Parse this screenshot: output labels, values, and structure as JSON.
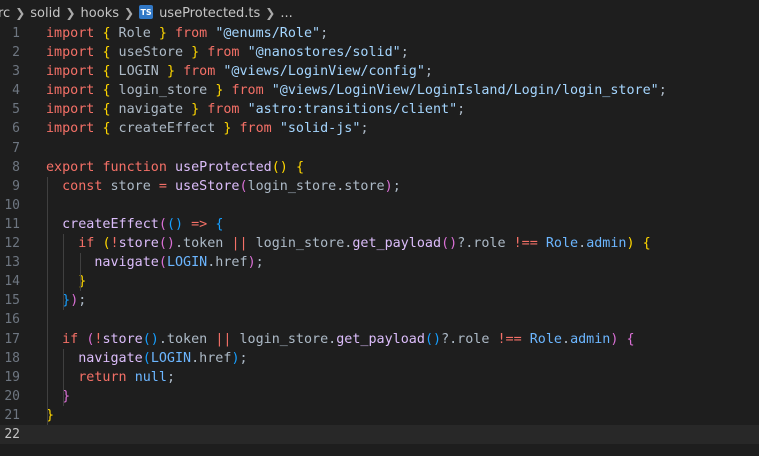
{
  "breadcrumb": {
    "items": [
      "rc",
      "solid",
      "hooks",
      "useProtected.ts",
      "..."
    ],
    "file_icon": "TS"
  },
  "editor": {
    "current_line": 22,
    "lines": [
      {
        "n": "1",
        "tokens": [
          [
            "kw",
            "import"
          ],
          [
            "p",
            " "
          ],
          [
            "b1",
            "{"
          ],
          [
            "p",
            " Role "
          ],
          [
            "b1",
            "}"
          ],
          [
            "p",
            " "
          ],
          [
            "kw",
            "from"
          ],
          [
            "p",
            " "
          ],
          [
            "str",
            "\"@enums/Role\""
          ],
          [
            "p",
            ";"
          ]
        ]
      },
      {
        "n": "2",
        "tokens": [
          [
            "kw",
            "import"
          ],
          [
            "p",
            " "
          ],
          [
            "b1",
            "{"
          ],
          [
            "p",
            " useStore "
          ],
          [
            "b1",
            "}"
          ],
          [
            "p",
            " "
          ],
          [
            "kw",
            "from"
          ],
          [
            "p",
            " "
          ],
          [
            "str",
            "\"@nanostores/solid\""
          ],
          [
            "p",
            ";"
          ]
        ]
      },
      {
        "n": "3",
        "tokens": [
          [
            "kw",
            "import"
          ],
          [
            "p",
            " "
          ],
          [
            "b1",
            "{"
          ],
          [
            "p",
            " LOGIN "
          ],
          [
            "b1",
            "}"
          ],
          [
            "p",
            " "
          ],
          [
            "kw",
            "from"
          ],
          [
            "p",
            " "
          ],
          [
            "str",
            "\"@views/LoginView/config\""
          ],
          [
            "p",
            ";"
          ]
        ]
      },
      {
        "n": "4",
        "tokens": [
          [
            "kw",
            "import"
          ],
          [
            "p",
            " "
          ],
          [
            "b1",
            "{"
          ],
          [
            "p",
            " login_store "
          ],
          [
            "b1",
            "}"
          ],
          [
            "p",
            " "
          ],
          [
            "kw",
            "from"
          ],
          [
            "p",
            " "
          ],
          [
            "str",
            "\"@views/LoginView/LoginIsland/Login/login_store\""
          ],
          [
            "p",
            ";"
          ]
        ]
      },
      {
        "n": "5",
        "tokens": [
          [
            "kw",
            "import"
          ],
          [
            "p",
            " "
          ],
          [
            "b1",
            "{"
          ],
          [
            "p",
            " navigate "
          ],
          [
            "b1",
            "}"
          ],
          [
            "p",
            " "
          ],
          [
            "kw",
            "from"
          ],
          [
            "p",
            " "
          ],
          [
            "str",
            "\"astro:transitions/client\""
          ],
          [
            "p",
            ";"
          ]
        ]
      },
      {
        "n": "6",
        "tokens": [
          [
            "kw",
            "import"
          ],
          [
            "p",
            " "
          ],
          [
            "b1",
            "{"
          ],
          [
            "p",
            " createEffect "
          ],
          [
            "b1",
            "}"
          ],
          [
            "p",
            " "
          ],
          [
            "kw",
            "from"
          ],
          [
            "p",
            " "
          ],
          [
            "str",
            "\"solid-js\""
          ],
          [
            "p",
            ";"
          ]
        ]
      },
      {
        "n": "7",
        "tokens": []
      },
      {
        "n": "8",
        "tokens": [
          [
            "kw",
            "export"
          ],
          [
            "p",
            " "
          ],
          [
            "kw",
            "function"
          ],
          [
            "p",
            " "
          ],
          [
            "fn",
            "useProtected"
          ],
          [
            "b1",
            "()"
          ],
          [
            "p",
            " "
          ],
          [
            "b1",
            "{"
          ]
        ]
      },
      {
        "n": "9",
        "tokens": [
          [
            "p",
            "  "
          ],
          [
            "kw",
            "const"
          ],
          [
            "p",
            " store "
          ],
          [
            "kw",
            "="
          ],
          [
            "p",
            " "
          ],
          [
            "fn",
            "useStore"
          ],
          [
            "b2",
            "("
          ],
          [
            "p",
            "login_store.store"
          ],
          [
            "b2",
            ")"
          ],
          [
            "p",
            ";"
          ]
        ]
      },
      {
        "n": "10",
        "tokens": []
      },
      {
        "n": "11",
        "tokens": [
          [
            "p",
            "  "
          ],
          [
            "fn",
            "createEffect"
          ],
          [
            "b2",
            "("
          ],
          [
            "b3",
            "()"
          ],
          [
            "p",
            " "
          ],
          [
            "kw",
            "=>"
          ],
          [
            "p",
            " "
          ],
          [
            "b3",
            "{"
          ]
        ]
      },
      {
        "n": "12",
        "tokens": [
          [
            "p",
            "    "
          ],
          [
            "kw",
            "if"
          ],
          [
            "p",
            " "
          ],
          [
            "b1",
            "("
          ],
          [
            "kw",
            "!"
          ],
          [
            "fn",
            "store"
          ],
          [
            "b2",
            "()"
          ],
          [
            "p",
            ".token "
          ],
          [
            "kw",
            "||"
          ],
          [
            "p",
            " login_store."
          ],
          [
            "fn",
            "get_payload"
          ],
          [
            "b2",
            "()"
          ],
          [
            "p",
            "?.role "
          ],
          [
            "kw",
            "!=="
          ],
          [
            "p",
            " "
          ],
          [
            "prop",
            "Role"
          ],
          [
            "p",
            "."
          ],
          [
            "prop",
            "admin"
          ],
          [
            "b1",
            ")"
          ],
          [
            "p",
            " "
          ],
          [
            "b1",
            "{"
          ]
        ]
      },
      {
        "n": "13",
        "tokens": [
          [
            "p",
            "      "
          ],
          [
            "fn",
            "navigate"
          ],
          [
            "b2",
            "("
          ],
          [
            "prop",
            "LOGIN"
          ],
          [
            "p",
            ".href"
          ],
          [
            "b2",
            ")"
          ],
          [
            "p",
            ";"
          ]
        ]
      },
      {
        "n": "14",
        "tokens": [
          [
            "p",
            "    "
          ],
          [
            "b1",
            "}"
          ]
        ]
      },
      {
        "n": "15",
        "tokens": [
          [
            "p",
            "  "
          ],
          [
            "b3",
            "}"
          ],
          [
            "b2",
            ")"
          ],
          [
            "p",
            ";"
          ]
        ]
      },
      {
        "n": "16",
        "tokens": []
      },
      {
        "n": "17",
        "tokens": [
          [
            "p",
            "  "
          ],
          [
            "kw",
            "if"
          ],
          [
            "p",
            " "
          ],
          [
            "b2",
            "("
          ],
          [
            "kw",
            "!"
          ],
          [
            "fn",
            "store"
          ],
          [
            "b3",
            "()"
          ],
          [
            "p",
            ".token "
          ],
          [
            "kw",
            "||"
          ],
          [
            "p",
            " login_store."
          ],
          [
            "fn",
            "get_payload"
          ],
          [
            "b3",
            "()"
          ],
          [
            "p",
            "?.role "
          ],
          [
            "kw",
            "!=="
          ],
          [
            "p",
            " "
          ],
          [
            "prop",
            "Role"
          ],
          [
            "p",
            "."
          ],
          [
            "prop",
            "admin"
          ],
          [
            "b2",
            ")"
          ],
          [
            "p",
            " "
          ],
          [
            "b2",
            "{"
          ]
        ]
      },
      {
        "n": "18",
        "tokens": [
          [
            "p",
            "    "
          ],
          [
            "fn",
            "navigate"
          ],
          [
            "b3",
            "("
          ],
          [
            "prop",
            "LOGIN"
          ],
          [
            "p",
            ".href"
          ],
          [
            "b3",
            ")"
          ],
          [
            "p",
            ";"
          ]
        ]
      },
      {
        "n": "19",
        "tokens": [
          [
            "p",
            "    "
          ],
          [
            "kw",
            "return"
          ],
          [
            "p",
            " "
          ],
          [
            "prop",
            "null"
          ],
          [
            "p",
            ";"
          ]
        ]
      },
      {
        "n": "20",
        "tokens": [
          [
            "p",
            "  "
          ],
          [
            "b2",
            "}"
          ]
        ]
      },
      {
        "n": "21",
        "tokens": [
          [
            "b1",
            "}"
          ]
        ]
      },
      {
        "n": "22",
        "tokens": []
      }
    ]
  }
}
